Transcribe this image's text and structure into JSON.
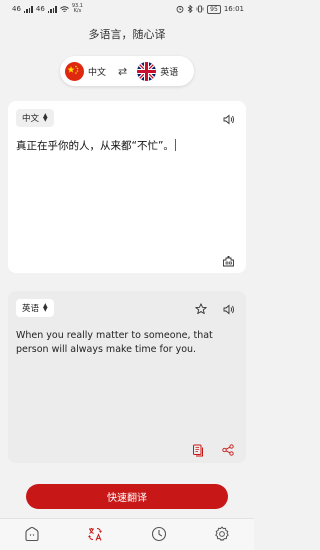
{
  "status_bar": {
    "network_left": "46",
    "network_right": "46",
    "speed": "93.1",
    "speed_unit": "K/s",
    "battery": "95",
    "time": "16:01"
  },
  "header": {
    "title": "多语言，随心译"
  },
  "language_switch": {
    "source_lang": "中文",
    "target_lang": "英语",
    "source_flag": "china-flag",
    "target_flag": "uk-flag",
    "swap_icon": "swap-arrows-icon"
  },
  "source_card": {
    "language": "中文",
    "text": "真正在乎你的人，从来都“不忙”。"
  },
  "target_card": {
    "language": "英语",
    "text": "When you really matter to someone, that person will always make time for you."
  },
  "translate_button": {
    "label": "快速翻译"
  },
  "bottom_nav": {
    "items": [
      "home-icon",
      "translate-icon",
      "history-icon",
      "settings-icon"
    ],
    "active": "translate-icon"
  },
  "colors": {
    "accent": "#c81717"
  }
}
